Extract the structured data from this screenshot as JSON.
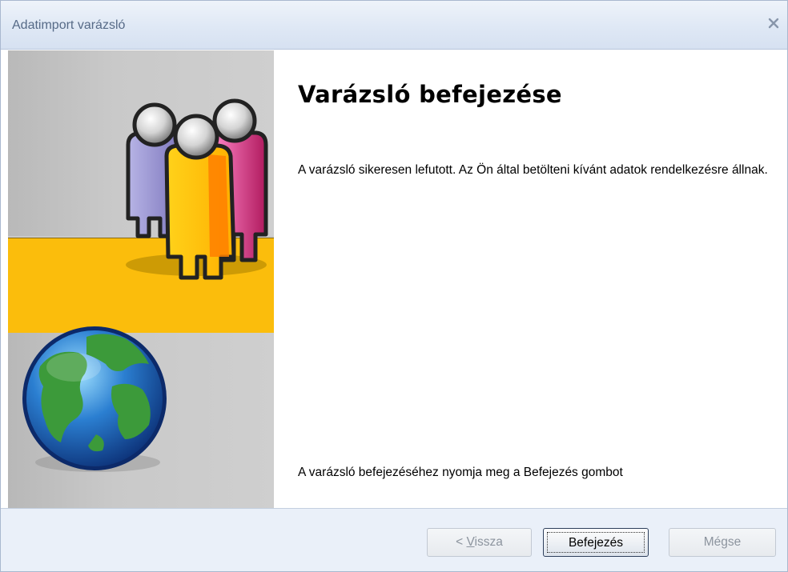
{
  "window": {
    "title": "Adatimport varázsló",
    "close_icon": "close-icon"
  },
  "banner": {
    "illustration": "people-icon",
    "globe": "globe-icon",
    "colors": {
      "band": "#fbbd0c",
      "background": "#c9c9c9"
    }
  },
  "main": {
    "heading": "Varázsló befejezése",
    "description": "A varázsló sikeresen lefutott. Az Ön által betölteni kívánt adatok rendelkezésre állnak.",
    "hint": "A varázsló befejezéséhez nyomja meg a Befejezés gombot"
  },
  "footer": {
    "back": {
      "prefix": "< ",
      "mnemonic": "V",
      "rest": "issza",
      "enabled": false
    },
    "finish": {
      "label": "Befejezés",
      "enabled": true,
      "focused": true
    },
    "cancel": {
      "label": "Mégse",
      "enabled": false
    }
  }
}
